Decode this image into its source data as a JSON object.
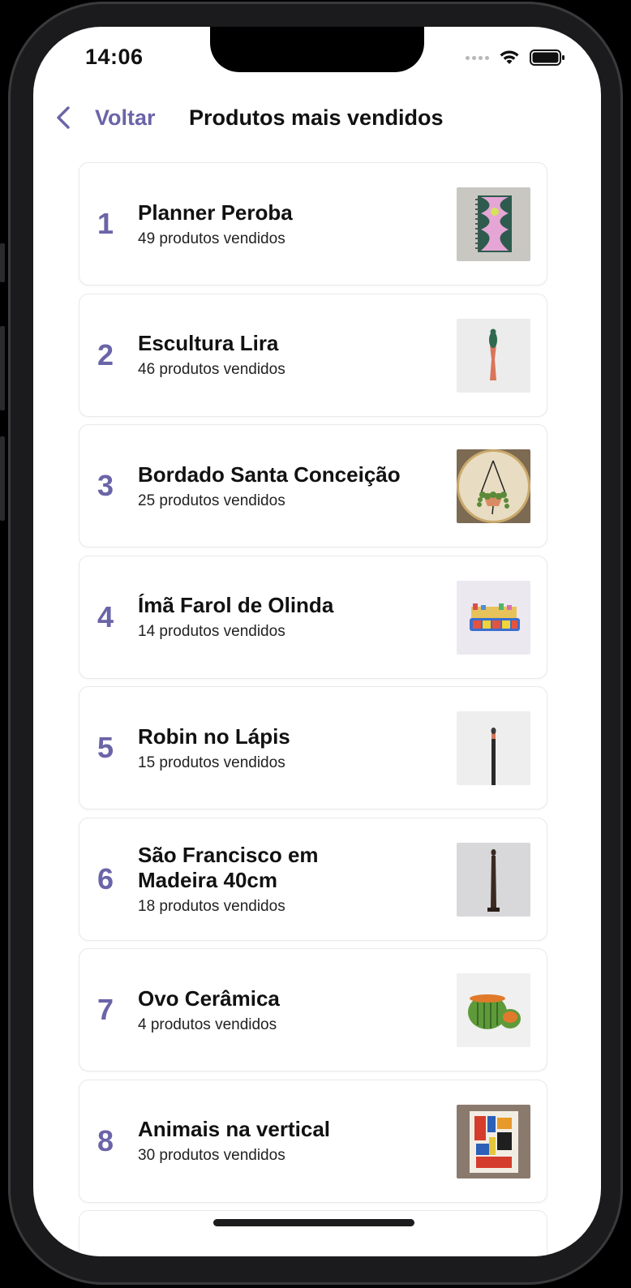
{
  "status_bar": {
    "time": "14:06"
  },
  "nav": {
    "back_label": "Voltar",
    "title": "Produtos mais vendidos"
  },
  "products": [
    {
      "rank": "1",
      "name": "Planner Peroba",
      "sold": "49 produtos vendidos",
      "thumb_icon": "planner-image"
    },
    {
      "rank": "2",
      "name": "Escultura Lira",
      "sold": "46 produtos vendidos",
      "thumb_icon": "sculpture-image"
    },
    {
      "rank": "3",
      "name": "Bordado Santa Conceição",
      "sold": "25 produtos vendidos",
      "thumb_icon": "embroidery-image"
    },
    {
      "rank": "4",
      "name": "Ímã Farol de Olinda",
      "sold": "14 produtos vendidos",
      "thumb_icon": "magnet-image"
    },
    {
      "rank": "5",
      "name": "Robin no Lápis",
      "sold": "15 produtos vendidos",
      "thumb_icon": "pencil-image"
    },
    {
      "rank": "6",
      "name": "São Francisco em Madeira 40cm",
      "sold": "18 produtos vendidos",
      "thumb_icon": "wood-statue-image"
    },
    {
      "rank": "7",
      "name": "Ovo Cerâmica",
      "sold": "4 produtos vendidos",
      "thumb_icon": "ceramic-egg-image"
    },
    {
      "rank": "8",
      "name": "Animais na vertical",
      "sold": "30 produtos vendidos",
      "thumb_icon": "painting-image"
    }
  ],
  "colors": {
    "accent": "#6a64a8",
    "text": "#111111",
    "card_border": "#e9e9ee"
  }
}
